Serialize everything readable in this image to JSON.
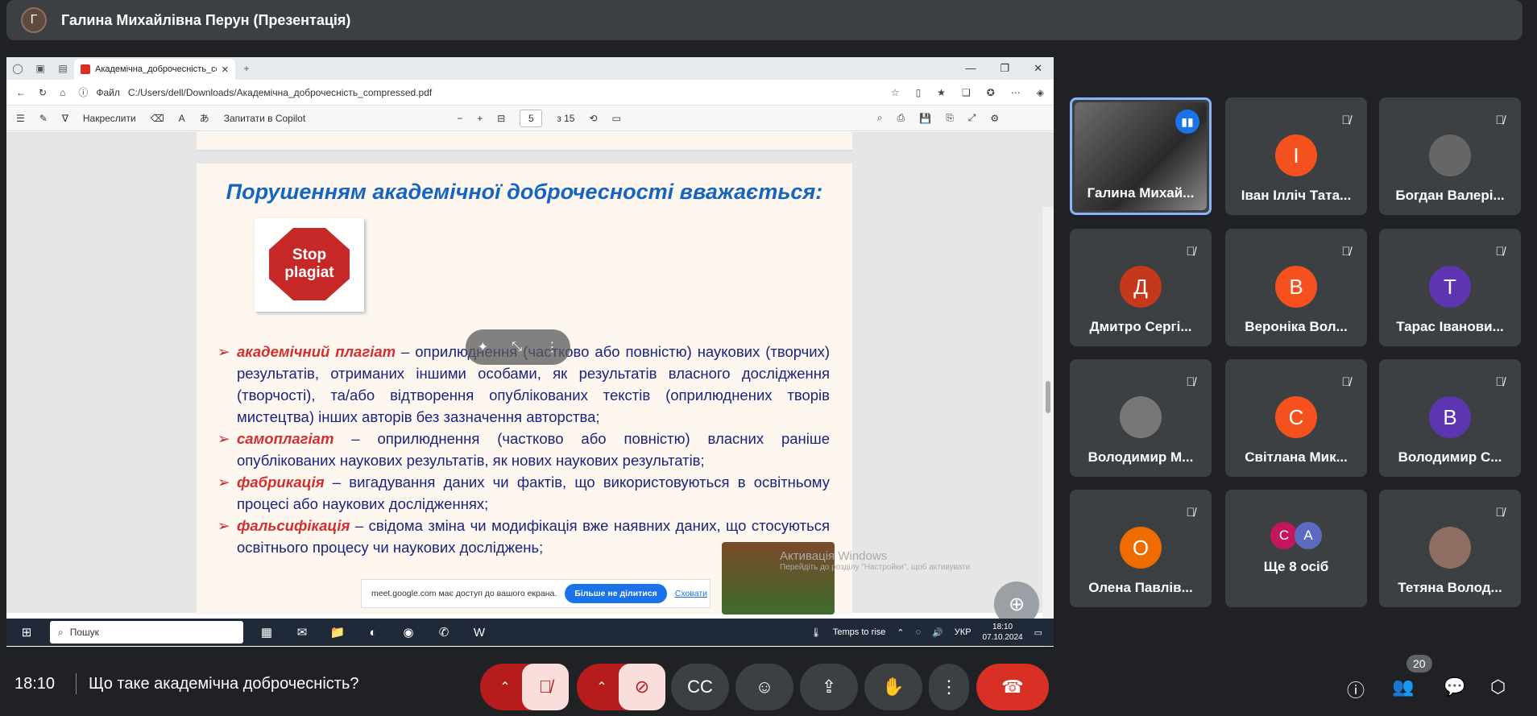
{
  "presenter": {
    "initial": "Г",
    "title": "Галина Михайлівна Перун (Презентація)"
  },
  "browser": {
    "tab_title": "Академічна_доброчесність_compressed.pdf",
    "file_label": "Файл",
    "url": "C:/Users/dell/Downloads/Академічна_доброчесність_compressed.pdf",
    "draw_label": "Накреслити",
    "copilot_label": "Запитати в Copilot",
    "page_current": "5",
    "page_total": "з 15"
  },
  "slide": {
    "title": "Порушенням академічної доброчесності вважається:",
    "stop_text": "Stop plagiat",
    "bullets": [
      {
        "term": "академічний плагіат",
        "text": " – оприлюднення (частково або повністю) наукових (творчих) результатів, отриманих іншими особами, як результатів власного дослідження (творчості), та/або відтворення опублікованих текстів (оприлюднених творів мистецтва) інших авторів без зазначення авторства;"
      },
      {
        "term": "самоплагіат",
        "text": " – оприлюднення (частково або повністю) власних раніше опублікованих наукових результатів, як нових наукових результатів;"
      },
      {
        "term": "фабрикація",
        "text": " – вигадування даних чи фактів, що використовуються в освітньому процесі або наукових дослідженнях;"
      },
      {
        "term": "фальсифікація",
        "text": " – свідома зміна чи модифікація вже наявних даних, що стосуються освітнього процесу чи наукових досліджень;"
      }
    ]
  },
  "share_notice": {
    "text": "meet.google.com має доступ до вашого екрана.",
    "stop": "Більше не ділитися",
    "hide": "Сховати"
  },
  "watermark": {
    "line1": "Активація Windows",
    "line2": "Перейдіть до розділу \"Настройки\", щоб активувати"
  },
  "taskbar": {
    "search": "Пошук",
    "weather": "Temps to rise",
    "lang": "УКР",
    "time": "18:10",
    "date": "07.10.2024"
  },
  "participants": [
    {
      "name": "Галина Михай...",
      "initial": "",
      "color": "#000000",
      "active": true
    },
    {
      "name": "Іван Ілліч Тата...",
      "initial": "І",
      "color": "#f4511e"
    },
    {
      "name": "Богдан Валері...",
      "initial": "",
      "color": "#666666"
    },
    {
      "name": "Дмитро Сергі...",
      "initial": "Д",
      "color": "#c5391a"
    },
    {
      "name": "Вероніка Вол...",
      "initial": "В",
      "color": "#f4511e"
    },
    {
      "name": "Тарас Іванови...",
      "initial": "Т",
      "color": "#5e35b1"
    },
    {
      "name": "Володимир М...",
      "initial": "",
      "color": "#777777"
    },
    {
      "name": "Світлана Мик...",
      "initial": "С",
      "color": "#f4511e"
    },
    {
      "name": "Володимир С...",
      "initial": "В",
      "color": "#5e35b1"
    },
    {
      "name": "Олена Павлів...",
      "initial": "О",
      "color": "#ef6c00"
    },
    {
      "name": "Ще 8 осіб",
      "initial": "",
      "color": "#3c4043"
    },
    {
      "name": "Тетяна Волод...",
      "initial": "",
      "color": "#8d6e63"
    }
  ],
  "more_initials": [
    "С",
    "А"
  ],
  "bottom": {
    "time": "18:10",
    "title": "Що таке академічна доброчесність?",
    "people_count": "20"
  }
}
